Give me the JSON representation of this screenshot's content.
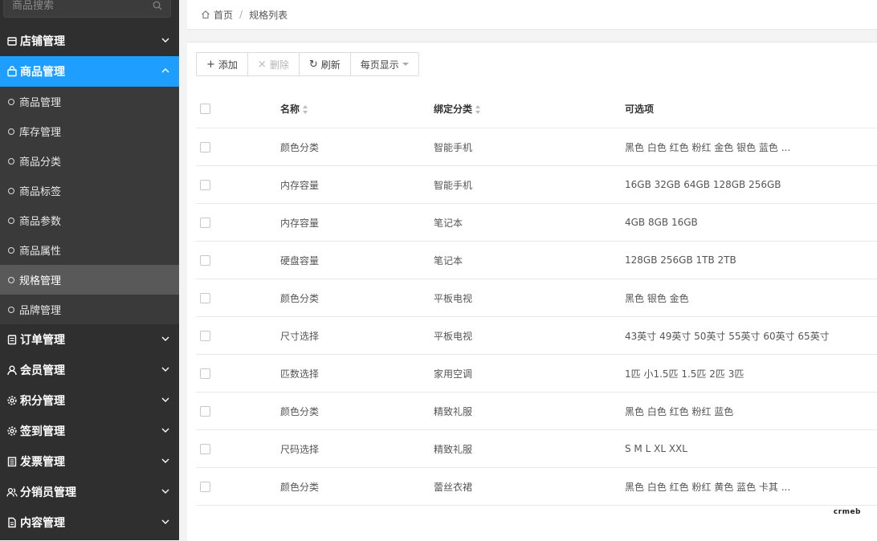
{
  "sidebar": {
    "search_placeholder": "商品搜索",
    "groups_top": [
      {
        "label": "店铺管理"
      }
    ],
    "active_group": {
      "label": "商品管理"
    },
    "sub_items": [
      {
        "label": "商品管理"
      },
      {
        "label": "库存管理"
      },
      {
        "label": "商品分类"
      },
      {
        "label": "商品标签"
      },
      {
        "label": "商品参数"
      },
      {
        "label": "商品属性"
      },
      {
        "label": "规格管理"
      },
      {
        "label": "品牌管理"
      }
    ],
    "selected_sub": "规格管理",
    "groups_bottom": [
      {
        "label": "订单管理",
        "icon": "order-icon"
      },
      {
        "label": "会员管理",
        "icon": "user-icon"
      },
      {
        "label": "积分管理",
        "icon": "gear-icon"
      },
      {
        "label": "签到管理",
        "icon": "gear-icon"
      },
      {
        "label": "发票管理",
        "icon": "invoice-icon"
      },
      {
        "label": "分销员管理",
        "icon": "users-icon"
      },
      {
        "label": "内容管理",
        "icon": "document-icon"
      }
    ],
    "accent_color": "#1e9fff"
  },
  "breadcrumb": {
    "home": "首页",
    "current": "规格列表"
  },
  "toolbar": {
    "add": "添加",
    "delete": "删除",
    "refresh": "刷新",
    "per_page": "每页显示"
  },
  "table": {
    "headers": {
      "name": "名称",
      "category": "绑定分类",
      "options": "可选项"
    },
    "rows": [
      {
        "name": "颜色分类",
        "category": "智能手机",
        "options": "黑色 白色 红色 粉红 金色 银色 蓝色 ..."
      },
      {
        "name": "内存容量",
        "category": "智能手机",
        "options": "16GB 32GB 64GB 128GB 256GB"
      },
      {
        "name": "内存容量",
        "category": "笔记本",
        "options": "4GB 8GB 16GB"
      },
      {
        "name": "硬盘容量",
        "category": "笔记本",
        "options": "128GB 256GB 1TB 2TB"
      },
      {
        "name": "颜色分类",
        "category": "平板电视",
        "options": "黑色 银色 金色"
      },
      {
        "name": "尺寸选择",
        "category": "平板电视",
        "options": "43英寸 49英寸 50英寸 55英寸 60英寸 65英寸"
      },
      {
        "name": "匹数选择",
        "category": "家用空调",
        "options": "1匹 小1.5匹 1.5匹 2匹 3匹"
      },
      {
        "name": "颜色分类",
        "category": "精致礼服",
        "options": "黑色 白色 红色 粉红 蓝色"
      },
      {
        "name": "尺码选择",
        "category": "精致礼服",
        "options": "S M L XL XXL"
      },
      {
        "name": "颜色分类",
        "category": "蕾丝衣裙",
        "options": "黑色 白色 红色 粉红 黄色 蓝色 卡其 ..."
      }
    ]
  },
  "brand": {
    "logo_text": "crmeb"
  }
}
